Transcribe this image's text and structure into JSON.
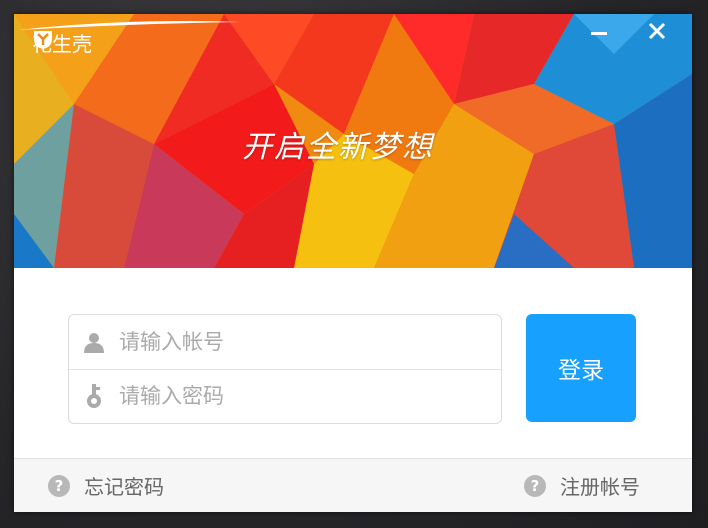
{
  "window": {
    "app_name": "花生壳",
    "minimize_icon": "minus-icon",
    "close_icon": "close-icon"
  },
  "banner": {
    "slogan": "开启全新梦想"
  },
  "login_form": {
    "account_placeholder": "请输入帐号",
    "account_value": "",
    "account_icon": "user-icon",
    "password_placeholder": "请输入密码",
    "password_value": "",
    "password_icon": "key-icon",
    "login_label": "登录"
  },
  "footer": {
    "forgot_label": "忘记密码",
    "register_label": "注册帐号",
    "help_icon": "question-icon"
  },
  "colors": {
    "accent": "#18a0ff",
    "footer_bg": "#f6f6f6",
    "placeholder": "#aaaaaa"
  }
}
